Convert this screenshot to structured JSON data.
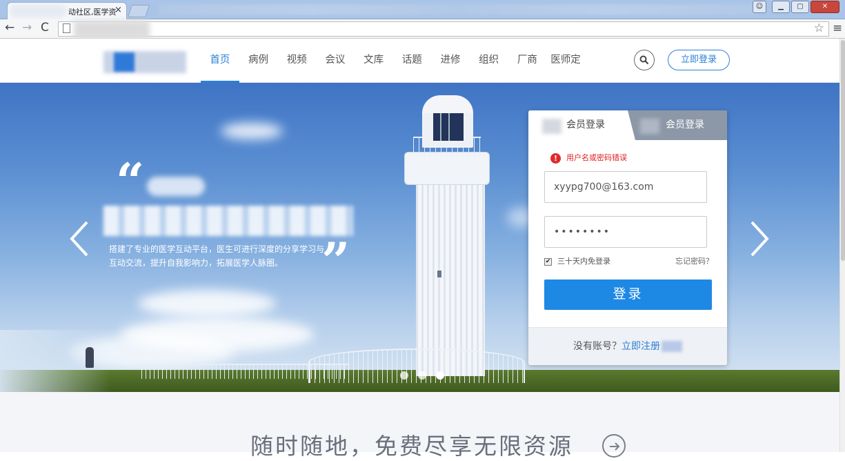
{
  "browser": {
    "tab_title": "动社区,医学资",
    "tab_close": "×",
    "nav_back": "←",
    "nav_forward": "→",
    "nav_reload": "C",
    "star": "☆",
    "menu": "≡"
  },
  "header": {
    "nav": [
      {
        "label": "首页",
        "active": true
      },
      {
        "label": "病例"
      },
      {
        "label": "视频"
      },
      {
        "label": "会议"
      },
      {
        "label": "文库"
      },
      {
        "label": "话题"
      },
      {
        "label": "进修"
      },
      {
        "label": "组织"
      },
      {
        "label": "厂商"
      },
      {
        "label": "医师定考"
      }
    ],
    "login_label": "立即登录"
  },
  "hero": {
    "quote_open": "“",
    "quote_close": "”",
    "description": "搭建了专业的医学互动平台，医生可进行深度的分享学习与互动交流，提升自我影响力，拓展医学人脉圈。",
    "slide_count": 3,
    "active_slide": 3
  },
  "login": {
    "tab1": "会员登录",
    "tab2": "会员登录",
    "error": "用户名或密码错误",
    "username": "xyypg700@163.com",
    "password": "••••••••",
    "remember": "三十天内免登录",
    "remember_checked": true,
    "forgot": "忘记密码？",
    "submit": "登录",
    "no_account": "没有账号？",
    "register": "立即注册"
  },
  "section": {
    "title": "随时随地，免费尽享无限资源"
  },
  "colors": {
    "accent": "#2a7fd6",
    "button": "#1e88e5",
    "error": "#e02020"
  }
}
